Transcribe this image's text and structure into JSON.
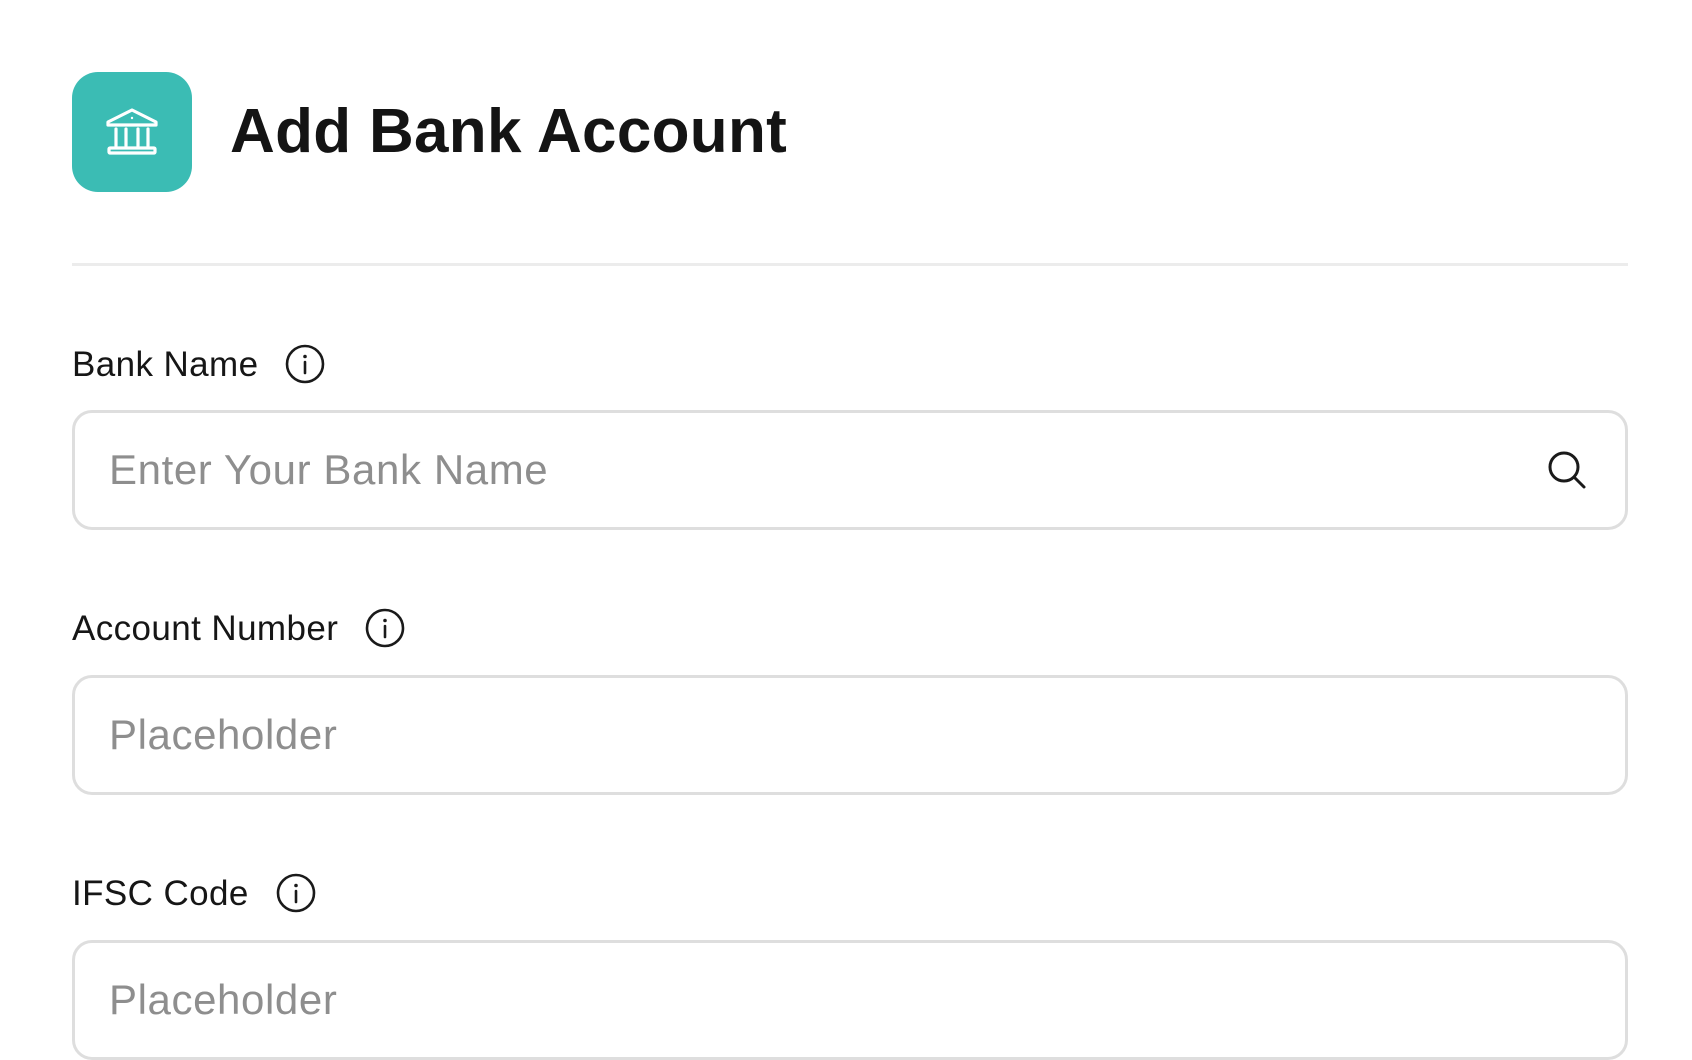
{
  "header": {
    "title": "Add Bank Account",
    "icon": "bank-icon"
  },
  "colors": {
    "accent": "#3bbcb4",
    "border": "#dedede",
    "placeholder": "#8e8e8e"
  },
  "form": {
    "bank_name": {
      "label": "Bank Name",
      "placeholder": "Enter Your Bank Name",
      "value": "",
      "icon": "search-icon",
      "info_icon": "info-icon"
    },
    "account_number": {
      "label": "Account Number",
      "placeholder": "Placeholder",
      "value": "",
      "info_icon": "info-icon"
    },
    "ifsc_code": {
      "label": "IFSC Code",
      "placeholder": "Placeholder",
      "value": "",
      "info_icon": "info-icon"
    }
  }
}
